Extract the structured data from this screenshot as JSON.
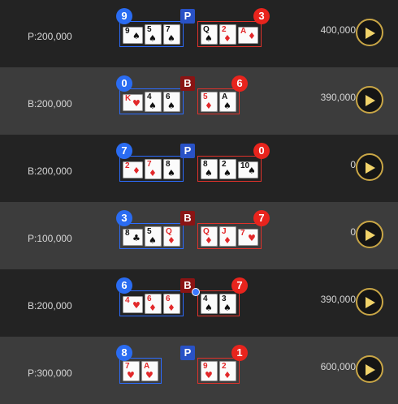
{
  "colors": {
    "player_blue": "#2a6cf2",
    "banker_red": "#e8241d",
    "play_gold": "#c9a646"
  },
  "rows": [
    {
      "bet": "P:200,000",
      "winnings": "400,000",
      "result": "P",
      "player_score": "9",
      "banker_score": "3",
      "player_cards": [
        {
          "rank": "9",
          "suit": "♠",
          "color": "blk",
          "side": true
        },
        {
          "rank": "5",
          "suit": "♠",
          "color": "blk"
        },
        {
          "rank": "7",
          "suit": "♠",
          "color": "blk"
        }
      ],
      "banker_cards": [
        {
          "rank": "Q",
          "suit": "♠",
          "color": "blk"
        },
        {
          "rank": "2",
          "suit": "♦",
          "color": "red"
        },
        {
          "rank": "A",
          "suit": "♦",
          "color": "red",
          "side": true
        }
      ]
    },
    {
      "bet": "B:200,000",
      "winnings": "390,000",
      "result": "B",
      "player_score": "0",
      "banker_score": "6",
      "player_cards": [
        {
          "rank": "K",
          "suit": "♥",
          "color": "red",
          "side": true
        },
        {
          "rank": "4",
          "suit": "♠",
          "color": "blk"
        },
        {
          "rank": "6",
          "suit": "♠",
          "color": "blk"
        }
      ],
      "banker_cards": [
        {
          "rank": "5",
          "suit": "♦",
          "color": "red"
        },
        {
          "rank": "A",
          "suit": "♠",
          "color": "blk"
        }
      ]
    },
    {
      "bet": "B:200,000",
      "winnings": "0",
      "result": "P",
      "player_score": "7",
      "banker_score": "0",
      "player_cards": [
        {
          "rank": "2",
          "suit": "♦",
          "color": "red",
          "side": true
        },
        {
          "rank": "7",
          "suit": "♦",
          "color": "red"
        },
        {
          "rank": "8",
          "suit": "♠",
          "color": "blk"
        }
      ],
      "banker_cards": [
        {
          "rank": "8",
          "suit": "♠",
          "color": "blk"
        },
        {
          "rank": "2",
          "suit": "♠",
          "color": "blk"
        },
        {
          "rank": "10",
          "suit": "♠",
          "color": "blk",
          "side": true
        }
      ]
    },
    {
      "bet": "P:100,000",
      "winnings": "0",
      "result": "B",
      "player_score": "3",
      "banker_score": "7",
      "player_cards": [
        {
          "rank": "8",
          "suit": "♣",
          "color": "blk",
          "side": true
        },
        {
          "rank": "5",
          "suit": "♠",
          "color": "blk"
        },
        {
          "rank": "Q",
          "suit": "♦",
          "color": "red"
        }
      ],
      "banker_cards": [
        {
          "rank": "Q",
          "suit": "♦",
          "color": "red"
        },
        {
          "rank": "J",
          "suit": "♦",
          "color": "red"
        },
        {
          "rank": "7",
          "suit": "♥",
          "color": "red",
          "side": true
        }
      ]
    },
    {
      "bet": "B:200,000",
      "winnings": "390,000",
      "result": "B",
      "player_score": "6",
      "banker_score": "7",
      "player_cards": [
        {
          "rank": "4",
          "suit": "♥",
          "color": "red",
          "side": true
        },
        {
          "rank": "6",
          "suit": "♦",
          "color": "red"
        },
        {
          "rank": "6",
          "suit": "♦",
          "color": "red"
        }
      ],
      "banker_cards": [
        {
          "rank": "4",
          "suit": "♠",
          "color": "blk"
        },
        {
          "rank": "3",
          "suit": "♠",
          "color": "blk"
        }
      ]
    },
    {
      "bet": "P:300,000",
      "winnings": "600,000",
      "result": "P",
      "player_score": "8",
      "banker_score": "1",
      "player_cards": [
        {
          "rank": "7",
          "suit": "♥",
          "color": "red"
        },
        {
          "rank": "A",
          "suit": "♥",
          "color": "red"
        }
      ],
      "banker_cards": [
        {
          "rank": "9",
          "suit": "♥",
          "color": "red"
        },
        {
          "rank": "2",
          "suit": "♦",
          "color": "red"
        }
      ]
    }
  ]
}
